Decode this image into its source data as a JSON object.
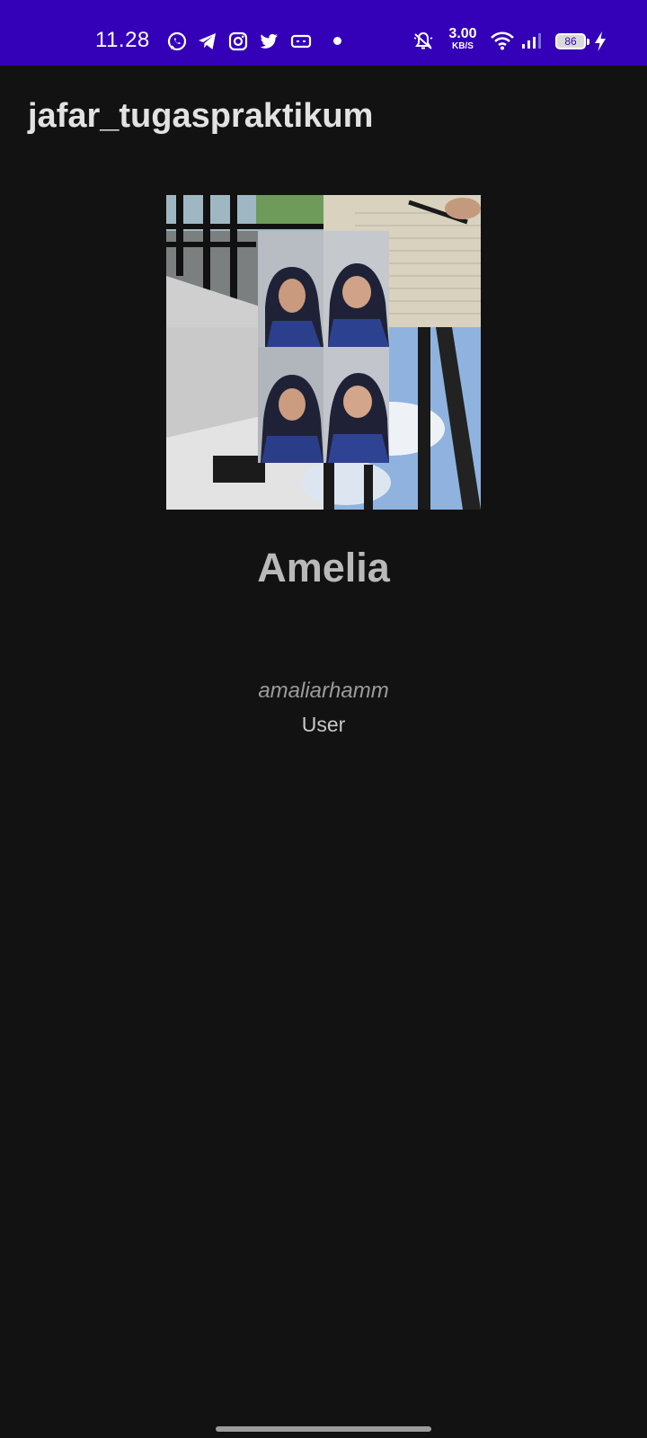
{
  "status_bar": {
    "time": "11.28",
    "notification_icons": [
      "whatsapp-icon",
      "telegram-icon",
      "instagram-icon",
      "twitter-icon",
      "game-controller-icon",
      "dot-icon"
    ],
    "net_speed_value": "3.00",
    "net_speed_unit": "KB/S",
    "battery_level": "86",
    "system_icons": [
      "mute-bell-icon",
      "wifi-icon",
      "signal-icon",
      "battery-icon",
      "charging-icon"
    ],
    "background_color": "#3400b8"
  },
  "app_bar": {
    "title": "jafar_tugaspraktikum"
  },
  "profile": {
    "photo": "profile-photo-collage",
    "name": "Amelia",
    "username": "amaliarhamm",
    "role": "User"
  },
  "colors": {
    "background": "#121212",
    "accent": "#3400b8"
  }
}
